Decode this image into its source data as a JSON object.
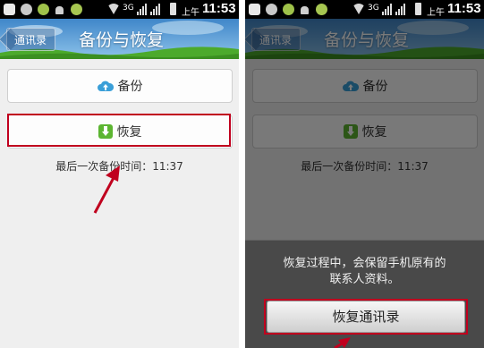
{
  "status_bar": {
    "network": "3G",
    "ampm": "上午",
    "time": "11:53"
  },
  "titlebar": {
    "back_label": "通讯录",
    "title": "备份与恢复"
  },
  "main": {
    "backup_label": "备份",
    "restore_label": "恢复",
    "last_backup_text": "最后一次备份时间：11:37"
  },
  "restore_dialog": {
    "message_line1": "恢复过程中，会保留手机原有的",
    "message_line2": "联系人资料。",
    "confirm_label": "恢复通讯录"
  },
  "colors": {
    "highlight": "#c0001e",
    "titlebar_sky": "#6aa7d8",
    "grass": "#4caa2c"
  },
  "icons": [
    "cloud-upload-icon",
    "download-icon",
    "back-arrow-icon"
  ]
}
